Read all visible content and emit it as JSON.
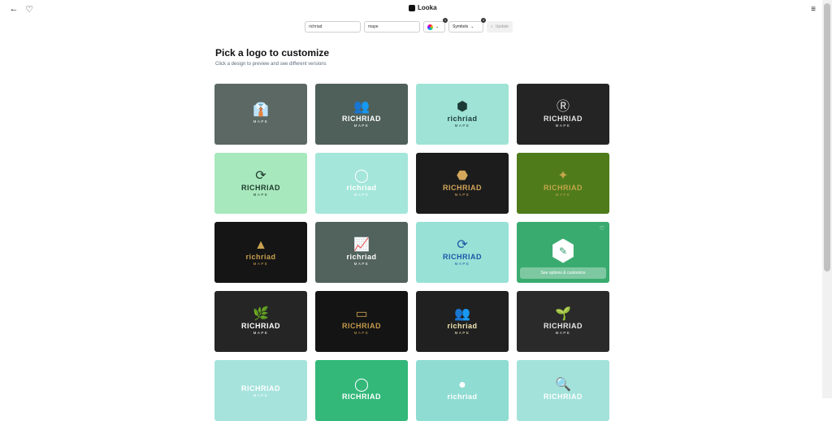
{
  "header": {
    "brand": "Looka",
    "back_icon": "arrow-left-icon",
    "fav_icon": "heart-icon",
    "menu_icon": "menu-icon"
  },
  "toolbar": {
    "name_value": "richriad",
    "slogan_value": "mape",
    "color_badge": "1",
    "symbols_label": "Symbols",
    "symbols_badge": "4",
    "update_label": "Update"
  },
  "main": {
    "title": "Pick a logo to customize",
    "subtitle": "Click a design to preview and see different versions",
    "overlay_label": "See options & customize"
  },
  "cards": [
    {
      "bg": "#5b6864",
      "fg": "#ffffff",
      "icon": "👔",
      "name": "",
      "sub": "MAPE"
    },
    {
      "bg": "#4f605a",
      "fg": "#ffffff",
      "icon": "👥",
      "name": "RICHRIAD",
      "sub": "MAPE"
    },
    {
      "bg": "#9fe3d6",
      "fg": "#1c3a36",
      "icon": "⬢",
      "name": "richriad",
      "sub": "MAPE"
    },
    {
      "bg": "#242424",
      "fg": "#e6e6e6",
      "icon": "Ⓡ",
      "name": "RICHRIAD",
      "sub": "MAPE"
    },
    {
      "bg": "#a8e8bd",
      "fg": "#1d3a2c",
      "icon": "⟳",
      "name": "RICHRIAD",
      "sub": "MAPE"
    },
    {
      "bg": "#a4e6da",
      "fg": "#ffffff",
      "icon": "◯",
      "name": "richriad",
      "sub": "MAPE"
    },
    {
      "bg": "#1c1c1c",
      "fg": "#d4a75b",
      "icon": "⬣",
      "name": "RICHRIAD",
      "sub": "MAPE"
    },
    {
      "bg": "#4f7b1b",
      "fg": "#c3a64a",
      "icon": "✦",
      "name": "RICHRIAD",
      "sub": "MAPE"
    },
    {
      "bg": "#151515",
      "fg": "#c9a24e",
      "icon": "▲",
      "name": "richriad",
      "sub": "MAPE"
    },
    {
      "bg": "#52625d",
      "fg": "#ffffff",
      "icon": "📈",
      "name": "richriad",
      "sub": "MAPE"
    },
    {
      "bg": "#97e1d6",
      "fg": "#1b57a8",
      "icon": "⟳",
      "name": "RICHRIAD",
      "sub": "MAPE"
    },
    {
      "bg": "#3aab6f",
      "fg": "#ffffff",
      "icon": "hex",
      "name": "",
      "sub": ""
    },
    {
      "bg": "#252525",
      "fg": "#ffffff",
      "icon": "🌿",
      "name": "RICHRIAD",
      "sub": "MAPE"
    },
    {
      "bg": "#141414",
      "fg": "#c39a4d",
      "icon": "▭",
      "name": "RICHRIAD",
      "sub": "MAPE"
    },
    {
      "bg": "#202020",
      "fg": "#f3e9b5",
      "icon": "👥",
      "name": "richriad",
      "sub": "MAPE"
    },
    {
      "bg": "#2a2a2a",
      "fg": "#e8e8e8",
      "icon": "🌱",
      "name": "RICHRIAD",
      "sub": "MAPE"
    },
    {
      "bg": "#a6e3dc",
      "fg": "#ffffff",
      "icon": "",
      "name": "RICHRIAD",
      "sub": "MAPE"
    },
    {
      "bg": "#33b87a",
      "fg": "#ffffff",
      "icon": "◯",
      "name": "RICHRIAD",
      "sub": ""
    },
    {
      "bg": "#8fdcd2",
      "fg": "#ffffff",
      "icon": "●",
      "name": "richriad",
      "sub": ""
    },
    {
      "bg": "#a2e2da",
      "fg": "#ffffff",
      "icon": "🔍",
      "name": "RICHRIAD",
      "sub": ""
    }
  ]
}
